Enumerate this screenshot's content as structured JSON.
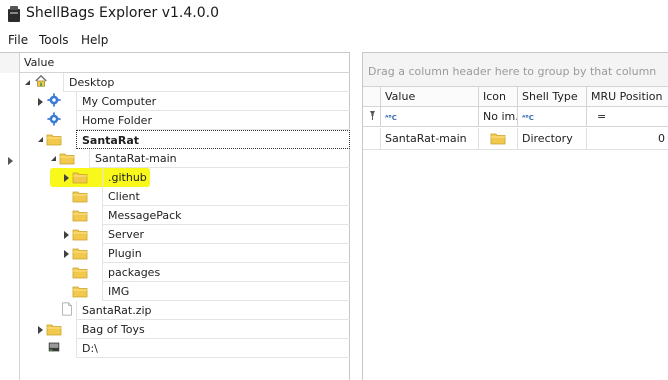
{
  "window": {
    "title": "ShellBags Explorer v1.4.0.0"
  },
  "menu": [
    "File",
    "Tools",
    "Help"
  ],
  "tree": {
    "column_header": "Value",
    "items": [
      {
        "label": "Desktop",
        "icon": "home-icon",
        "expander": "open",
        "bold": false
      },
      {
        "label": "My Computer",
        "icon": "gear-icon",
        "expander": "closed",
        "bold": false
      },
      {
        "label": "Home Folder",
        "icon": "gear-icon",
        "expander": "none",
        "bold": false
      },
      {
        "label": "SantaRat",
        "icon": "folder-icon",
        "expander": "open",
        "bold": true,
        "selected": true
      },
      {
        "label": "SantaRat-main",
        "icon": "folder-icon",
        "expander": "open",
        "bold": false
      },
      {
        "label": ".github",
        "icon": "folder-icon",
        "expander": "closed",
        "bold": false,
        "highlighted": true
      },
      {
        "label": "Client",
        "icon": "folder-icon",
        "expander": "none",
        "bold": false
      },
      {
        "label": "MessagePack",
        "icon": "folder-icon",
        "expander": "none",
        "bold": false
      },
      {
        "label": "Server",
        "icon": "folder-icon",
        "expander": "closed",
        "bold": false
      },
      {
        "label": "Plugin",
        "icon": "folder-icon",
        "expander": "closed",
        "bold": false
      },
      {
        "label": "packages",
        "icon": "folder-icon",
        "expander": "none",
        "bold": false
      },
      {
        "label": "IMG",
        "icon": "folder-icon",
        "expander": "none",
        "bold": false
      },
      {
        "label": "SantaRat.zip",
        "icon": "file-icon",
        "expander": "none",
        "bold": false
      },
      {
        "label": "Bag of Toys",
        "icon": "folder-icon",
        "expander": "closed",
        "bold": false
      },
      {
        "label": "D:\\",
        "icon": "drive-icon",
        "expander": "none",
        "bold": false
      }
    ]
  },
  "grid": {
    "group_placeholder": "Drag a column header here to group by that column",
    "columns": [
      "Value",
      "Icon",
      "Shell Type",
      "MRU Position"
    ],
    "filter": {
      "value": "",
      "icon": "No im...",
      "shell_type": "",
      "mru": "="
    },
    "rows": [
      {
        "value": "SantaRat-main",
        "icon": "folder-icon",
        "shell_type": "Directory",
        "mru": "0"
      }
    ]
  },
  "colors": {
    "highlight": "#f8f81a",
    "folder": "#f2c94c",
    "gear": "#3a7bd5"
  }
}
